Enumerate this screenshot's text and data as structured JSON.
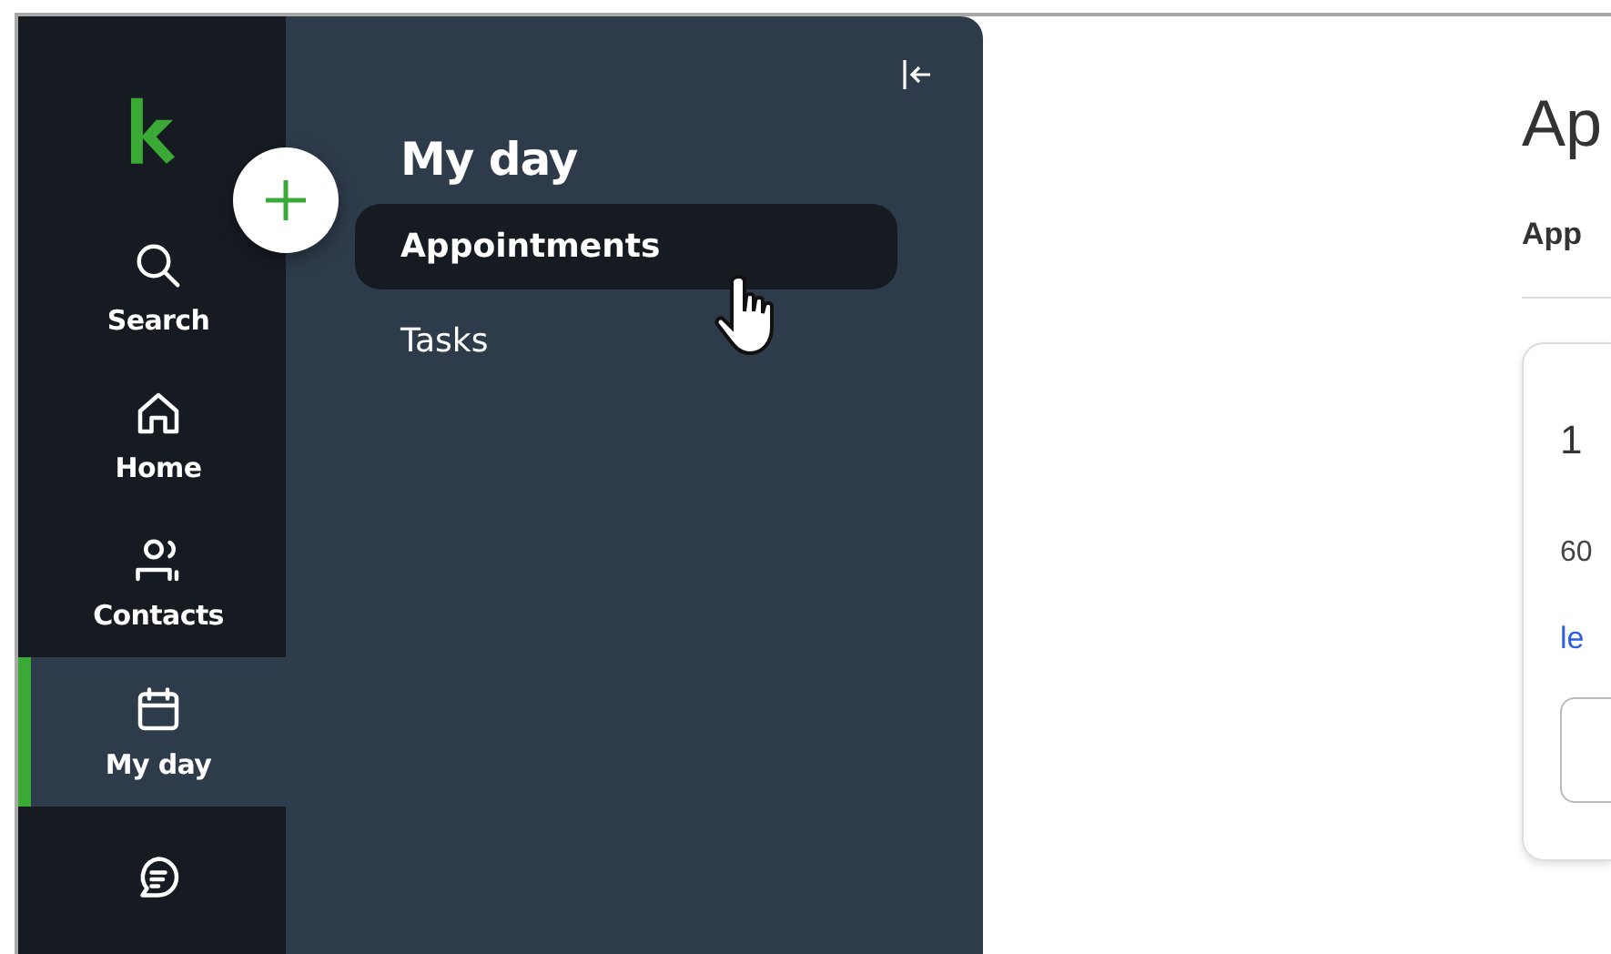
{
  "rail": {
    "items": [
      {
        "label": "Search",
        "selected": false
      },
      {
        "label": "Home",
        "selected": false
      },
      {
        "label": "Contacts",
        "selected": false
      },
      {
        "label": "My day",
        "selected": true
      }
    ]
  },
  "panel": {
    "title": "My day",
    "items": [
      {
        "label": "Appointments",
        "selected": true
      },
      {
        "label": "Tasks",
        "selected": false
      }
    ]
  },
  "main": {
    "title": "Ap",
    "section": "App",
    "card": {
      "title": "1",
      "text": "60",
      "link": "le"
    }
  }
}
